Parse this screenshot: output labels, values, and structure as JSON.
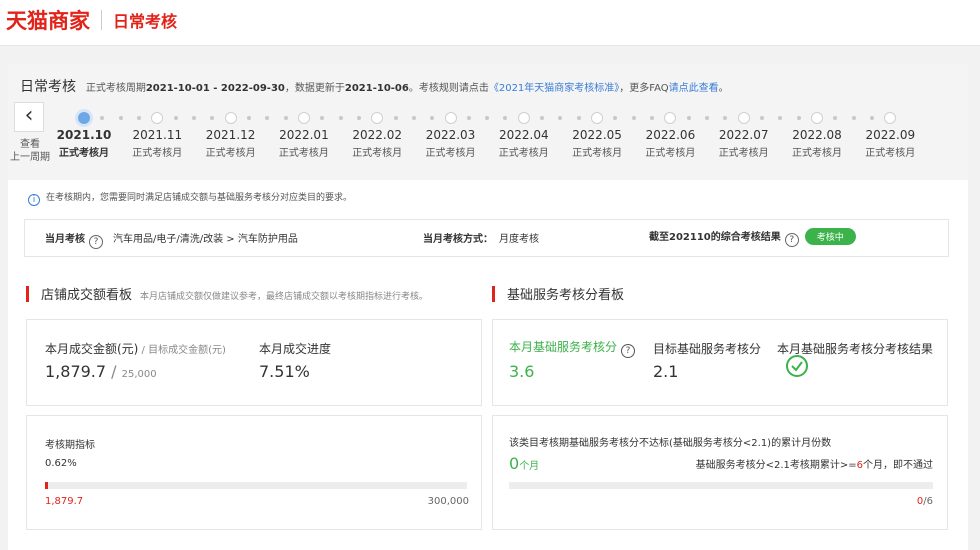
{
  "header": {
    "logo": "天猫商家",
    "page_title": "日常考核"
  },
  "summary": {
    "title": "日常考核",
    "period_prefix": "正式考核周期",
    "period": "2021-10-01 - 2022-09-30",
    "update_prefix": "，数据更新于",
    "update_date": "2021-10-06",
    "rules_prefix": "。考核规则请点击",
    "rules_link": "《2021年天猫商家考核标准》",
    "faq_prefix": "，更多FAQ",
    "faq_link": "请点此查看",
    "faq_suffix": "。"
  },
  "timeline": {
    "prev_label_1": "查看",
    "prev_label_2": "上一周期",
    "periods": [
      {
        "month": "2021.10",
        "label": "正式考核月"
      },
      {
        "month": "2021.11",
        "label": "正式考核月"
      },
      {
        "month": "2021.12",
        "label": "正式考核月"
      },
      {
        "month": "2022.01",
        "label": "正式考核月"
      },
      {
        "month": "2022.02",
        "label": "正式考核月"
      },
      {
        "month": "2022.03",
        "label": "正式考核月"
      },
      {
        "month": "2022.04",
        "label": "正式考核月"
      },
      {
        "month": "2022.05",
        "label": "正式考核月"
      },
      {
        "month": "2022.06",
        "label": "正式考核月"
      },
      {
        "month": "2022.07",
        "label": "正式考核月"
      },
      {
        "month": "2022.08",
        "label": "正式考核月"
      },
      {
        "month": "2022.09",
        "label": "正式考核月"
      }
    ],
    "active_index": 0
  },
  "notice": "在考核期内，您需要同时满足店铺成交额与基础服务考核分对应类目的要求。",
  "criteria": {
    "monthly_label": "当月考核",
    "category": "汽车用品/电子/清洗/改装 > 汽车防护用品",
    "method_label": "当月考核方式：",
    "method_value": "月度考核",
    "result_label": "截至202110的综合考核结果",
    "result_status": "考核中"
  },
  "sales": {
    "title": "店铺成交额看板",
    "note": "本月店铺成交额仅做建议参考，最终店铺成交额以考核期指标进行考核。",
    "amount_label": "本月成交金额(元)",
    "target_label": "目标成交金额(元)",
    "amount": "1,879.7",
    "target": "25,000",
    "progress_label": "本月成交进度",
    "progress": "7.51%",
    "period_indicator_label": "考核期指标",
    "period_percent": "0.62%",
    "period_progress_fraction": 0.0062,
    "period_current": "1,879.7",
    "period_target": "300,000"
  },
  "service": {
    "title": "基础服务考核分看板",
    "score_label": "本月基础服务考核分",
    "score": "3.6",
    "target_label": "目标基础服务考核分",
    "target": "2.1",
    "result_label": "本月基础服务考核分考核结果",
    "fail_desc": "该类目考核期基础服务考核分不达标(基础服务考核分<2.1)的累计月份数",
    "fail_months": "0",
    "months_unit": "个月",
    "rule_prefix": "基础服务考核分<2.1考核期累计>=",
    "rule_months": "6",
    "rule_suffix": "个月，即不通过",
    "fail_count": "0",
    "fail_total": "/6",
    "fail_fraction": 0
  },
  "colors": {
    "brand_red": "#e2231a",
    "success_green": "#3cb24a",
    "link_blue": "#3a7dd6",
    "active_dot": "#6ea7e6"
  }
}
